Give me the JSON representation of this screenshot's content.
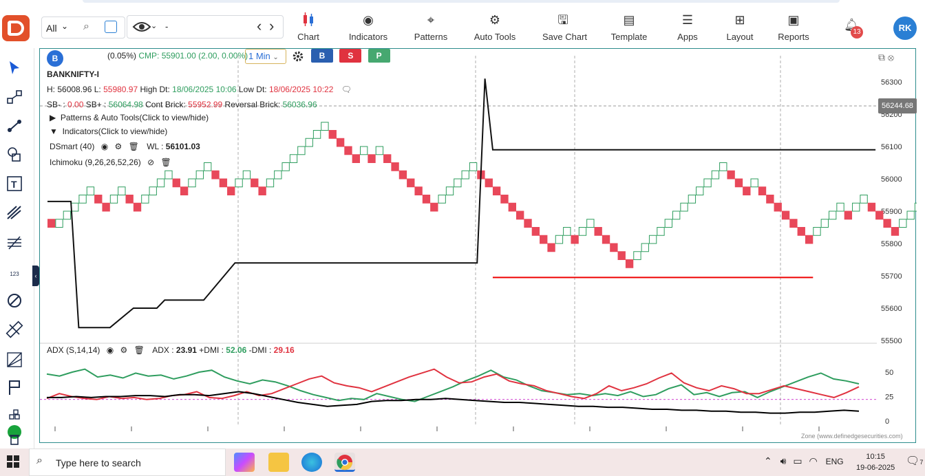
{
  "toolbar": {
    "exchange_select": "All",
    "symbol_value": "-",
    "items": [
      {
        "label": "Chart",
        "icon": "candlestick-icon"
      },
      {
        "label": "Indicators",
        "icon": "indicators-icon"
      },
      {
        "label": "Patterns",
        "icon": "patterns-icon"
      },
      {
        "label": "Auto Tools",
        "icon": "auto-tools-icon"
      },
      {
        "label": "Save Chart",
        "icon": "save-icon"
      },
      {
        "label": "Template",
        "icon": "template-icon"
      },
      {
        "label": "Apps",
        "icon": "apps-icon"
      },
      {
        "label": "Layout",
        "icon": "layout-icon"
      },
      {
        "label": "Reports",
        "icon": "reports-icon"
      }
    ],
    "notification_count": "13",
    "avatar_initials": "RK"
  },
  "sidebar": {
    "icons": [
      "cursor-icon",
      "line-tool-icon",
      "trend-line-icon",
      "shapes-icon",
      "text-tool-icon",
      "fork-icon",
      "fib-icon",
      "number-icon",
      "cycle-icon",
      "ruler-icon",
      "gann-icon",
      "flag-icon",
      "stack-icon",
      "trash-icon"
    ],
    "number_label": "123"
  },
  "chart_header": {
    "badge": "B",
    "change": "(0.05%)",
    "cmp": "CMP: 55901.00 (2.00, 0.00%)",
    "timeframe": "1 Min",
    "buttons": [
      "B",
      "S",
      "P"
    ],
    "symbol": "BANKNIFTY-I",
    "h_label": "H: ",
    "h_value": "56008.96",
    "l_label": " L: ",
    "l_value": "55980.97",
    "high_dt": " High Dt: ",
    "high_dt_value": "18/06/2025 10:06",
    "low_dt": " Low Dt: ",
    "low_dt_value": "18/06/2025 10:22",
    "sb_minus_label": "SB- : ",
    "sb_minus_value": "0.00",
    "sb_plus_label": " SB+ : ",
    "sb_plus_value": "56064.98",
    "cont_label": " Cont Brick: ",
    "cont_value": "55952.99",
    "rev_label": " Reversal Brick: ",
    "rev_value": "56036.96",
    "patterns_toggle": "Patterns & Auto Tools(Click to view/hide)",
    "indicators_toggle": "Indicators(Click to view/hide)",
    "dsmart": "DSmart (40)",
    "wl_label": "WL : ",
    "wl_value": "56101.03",
    "ichimoku": "Ichimoku (9,26,26,52,26)",
    "price_tag": "56244.68",
    "watermark": "Zone (www.definedgesecurities.com)"
  },
  "chart_data": [
    {
      "type": "line",
      "title": "BANKNIFTY-I Renko",
      "y_ticks": [
        56300,
        56200,
        56100,
        56000,
        55900,
        55800,
        55700,
        55600,
        55500
      ],
      "bricks": [
        {
          "dir": "dn",
          "v": 55850
        },
        {
          "dir": "up",
          "v": 55850
        },
        {
          "dir": "up",
          "v": 55875
        },
        {
          "dir": "up",
          "v": 55900
        },
        {
          "dir": "up",
          "v": 55925
        },
        {
          "dir": "up",
          "v": 55950
        },
        {
          "dir": "dn",
          "v": 55925
        },
        {
          "dir": "dn",
          "v": 55900
        },
        {
          "dir": "up",
          "v": 55925
        },
        {
          "dir": "up",
          "v": 55950
        },
        {
          "dir": "dn",
          "v": 55925
        },
        {
          "dir": "dn",
          "v": 55900
        },
        {
          "dir": "up",
          "v": 55925
        },
        {
          "dir": "up",
          "v": 55950
        },
        {
          "dir": "up",
          "v": 55975
        },
        {
          "dir": "up",
          "v": 56000
        },
        {
          "dir": "dn",
          "v": 55975
        },
        {
          "dir": "dn",
          "v": 55950
        },
        {
          "dir": "up",
          "v": 55975
        },
        {
          "dir": "up",
          "v": 56000
        },
        {
          "dir": "up",
          "v": 56025
        },
        {
          "dir": "dn",
          "v": 56000
        },
        {
          "dir": "dn",
          "v": 55975
        },
        {
          "dir": "dn",
          "v": 55950
        },
        {
          "dir": "up",
          "v": 55975
        },
        {
          "dir": "up",
          "v": 56000
        },
        {
          "dir": "dn",
          "v": 55975
        },
        {
          "dir": "dn",
          "v": 55950
        },
        {
          "dir": "up",
          "v": 55975
        },
        {
          "dir": "up",
          "v": 56000
        },
        {
          "dir": "up",
          "v": 56025
        },
        {
          "dir": "up",
          "v": 56050
        },
        {
          "dir": "up",
          "v": 56075
        },
        {
          "dir": "up",
          "v": 56100
        },
        {
          "dir": "up",
          "v": 56125
        },
        {
          "dir": "up",
          "v": 56150
        },
        {
          "dir": "dn",
          "v": 56125
        },
        {
          "dir": "dn",
          "v": 56100
        },
        {
          "dir": "dn",
          "v": 56075
        },
        {
          "dir": "dn",
          "v": 56050
        },
        {
          "dir": "up",
          "v": 56075
        },
        {
          "dir": "dn",
          "v": 56050
        },
        {
          "dir": "up",
          "v": 56075
        },
        {
          "dir": "dn",
          "v": 56050
        },
        {
          "dir": "dn",
          "v": 56025
        },
        {
          "dir": "dn",
          "v": 56000
        },
        {
          "dir": "dn",
          "v": 55975
        },
        {
          "dir": "dn",
          "v": 55950
        },
        {
          "dir": "dn",
          "v": 55925
        },
        {
          "dir": "dn",
          "v": 55900
        },
        {
          "dir": "up",
          "v": 55925
        },
        {
          "dir": "up",
          "v": 55950
        },
        {
          "dir": "up",
          "v": 55975
        },
        {
          "dir": "up",
          "v": 56000
        },
        {
          "dir": "up",
          "v": 56025
        },
        {
          "dir": "dn",
          "v": 56000
        },
        {
          "dir": "dn",
          "v": 55975
        },
        {
          "dir": "dn",
          "v": 55950
        },
        {
          "dir": "dn",
          "v": 55925
        },
        {
          "dir": "dn",
          "v": 55900
        },
        {
          "dir": "dn",
          "v": 55875
        },
        {
          "dir": "dn",
          "v": 55850
        },
        {
          "dir": "dn",
          "v": 55825
        },
        {
          "dir": "dn",
          "v": 55800
        },
        {
          "dir": "dn",
          "v": 55775
        },
        {
          "dir": "up",
          "v": 55800
        },
        {
          "dir": "up",
          "v": 55825
        },
        {
          "dir": "dn",
          "v": 55800
        },
        {
          "dir": "up",
          "v": 55825
        },
        {
          "dir": "up",
          "v": 55850
        },
        {
          "dir": "dn",
          "v": 55825
        },
        {
          "dir": "dn",
          "v": 55800
        },
        {
          "dir": "dn",
          "v": 55775
        },
        {
          "dir": "dn",
          "v": 55750
        },
        {
          "dir": "dn",
          "v": 55725
        },
        {
          "dir": "up",
          "v": 55750
        },
        {
          "dir": "up",
          "v": 55775
        },
        {
          "dir": "up",
          "v": 55800
        },
        {
          "dir": "up",
          "v": 55825
        },
        {
          "dir": "up",
          "v": 55850
        },
        {
          "dir": "up",
          "v": 55875
        },
        {
          "dir": "up",
          "v": 55900
        },
        {
          "dir": "up",
          "v": 55925
        },
        {
          "dir": "up",
          "v": 55950
        },
        {
          "dir": "up",
          "v": 55975
        },
        {
          "dir": "up",
          "v": 56000
        },
        {
          "dir": "up",
          "v": 56025
        },
        {
          "dir": "dn",
          "v": 56000
        },
        {
          "dir": "dn",
          "v": 55975
        },
        {
          "dir": "dn",
          "v": 55950
        },
        {
          "dir": "up",
          "v": 55975
        },
        {
          "dir": "dn",
          "v": 55950
        },
        {
          "dir": "dn",
          "v": 55925
        },
        {
          "dir": "dn",
          "v": 55900
        },
        {
          "dir": "dn",
          "v": 55875
        },
        {
          "dir": "dn",
          "v": 55850
        },
        {
          "dir": "dn",
          "v": 55825
        },
        {
          "dir": "dn",
          "v": 55800
        },
        {
          "dir": "up",
          "v": 55825
        },
        {
          "dir": "up",
          "v": 55850
        },
        {
          "dir": "up",
          "v": 55875
        },
        {
          "dir": "up",
          "v": 55900
        },
        {
          "dir": "dn",
          "v": 55875
        },
        {
          "dir": "up",
          "v": 55900
        },
        {
          "dir": "up",
          "v": 55925
        },
        {
          "dir": "dn",
          "v": 55900
        },
        {
          "dir": "dn",
          "v": 55875
        },
        {
          "dir": "dn",
          "v": 55850
        },
        {
          "dir": "dn",
          "v": 55825
        },
        {
          "dir": "up",
          "v": 55850
        },
        {
          "dir": "up",
          "v": 55875
        },
        {
          "dir": "up",
          "v": 55900
        },
        {
          "dir": "dn",
          "v": 55875
        },
        {
          "dir": "dn",
          "v": 55850
        },
        {
          "dir": "up",
          "v": 55875
        },
        {
          "dir": "up",
          "v": 55900
        },
        {
          "dir": "up",
          "v": 55925
        },
        {
          "dir": "up",
          "v": 55950
        },
        {
          "dir": "up",
          "v": 55975
        },
        {
          "dir": "up",
          "v": 56000
        },
        {
          "dir": "dn",
          "v": 55975
        },
        {
          "dir": "dn",
          "v": 55950
        },
        {
          "dir": "dn",
          "v": 55925
        }
      ],
      "dsmart_line": [
        {
          "i": 0,
          "v": 55930
        },
        {
          "i": 3,
          "v": 55930
        },
        {
          "i": 4,
          "v": 55540
        },
        {
          "i": 8,
          "v": 55540
        },
        {
          "i": 11,
          "v": 55600
        },
        {
          "i": 14,
          "v": 55600
        },
        {
          "i": 15,
          "v": 55625
        },
        {
          "i": 20,
          "v": 55625
        },
        {
          "i": 24,
          "v": 55740
        },
        {
          "i": 55,
          "v": 55740
        },
        {
          "i": 56,
          "v": 56310
        },
        {
          "i": 57,
          "v": 56090
        },
        {
          "i": 106,
          "v": 56090
        }
      ],
      "support_line": {
        "v": 55695,
        "from": 57,
        "to": 98
      }
    },
    {
      "type": "line",
      "title": "ADX (S,14,14)",
      "labels": {
        "adx_label": "ADX : ",
        "adx": "23.91",
        "pdmi_label": " +DMI : ",
        "pdmi": "52.06",
        "mdmi_label": " -DMI : ",
        "mdmi": "29.16"
      },
      "y_ticks": [
        50,
        25,
        0
      ],
      "ref_level": 22,
      "series": [
        {
          "name": "+DMI",
          "color": "#2e9d5e",
          "values": [
            48,
            46,
            50,
            53,
            45,
            47,
            44,
            49,
            46,
            47,
            43,
            46,
            50,
            52,
            45,
            41,
            38,
            42,
            40,
            36,
            31,
            27,
            24,
            21,
            23,
            22,
            28,
            25,
            22,
            20,
            25,
            30,
            35,
            41,
            46,
            52,
            45,
            42,
            36,
            31,
            29,
            27,
            28,
            26,
            28,
            26,
            30,
            25,
            27,
            33,
            37,
            27,
            29,
            25,
            29,
            30,
            24,
            30,
            35,
            40,
            45,
            49,
            43,
            41,
            38
          ]
        },
        {
          "name": "-DMI",
          "color": "#e0323f",
          "values": [
            23,
            28,
            25,
            23,
            22,
            25,
            23,
            24,
            22,
            23,
            26,
            27,
            30,
            24,
            23,
            26,
            30,
            26,
            28,
            33,
            38,
            43,
            46,
            39,
            36,
            34,
            30,
            35,
            40,
            45,
            49,
            53,
            45,
            39,
            40,
            45,
            48,
            41,
            38,
            36,
            31,
            28,
            25,
            23,
            28,
            36,
            31,
            34,
            38,
            44,
            49,
            39,
            34,
            31,
            36,
            33,
            28,
            28,
            32,
            36,
            33,
            30,
            27,
            24,
            29,
            35
          ]
        },
        {
          "name": "ADX",
          "color": "#000000",
          "values": [
            24,
            24,
            25,
            24,
            25,
            25,
            26,
            26,
            25,
            27,
            27,
            26,
            28,
            30,
            28,
            25,
            22,
            19,
            17,
            15,
            16,
            17,
            20,
            21,
            21,
            22,
            22,
            23,
            22,
            21,
            20,
            19,
            19,
            18,
            17,
            16,
            15,
            15,
            14,
            14,
            13,
            12,
            12,
            11,
            11,
            10,
            10,
            9,
            9,
            8,
            8,
            9,
            9,
            10,
            11,
            10
          ]
        }
      ]
    }
  ],
  "taskbar": {
    "search_placeholder": "Type here to search",
    "lang": "ENG",
    "time": "10:15",
    "date": "19-06-2025",
    "notif_count": "7"
  }
}
